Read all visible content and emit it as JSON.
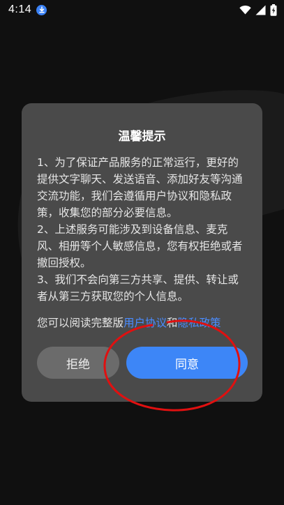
{
  "status_bar": {
    "time": "4:14",
    "icons": [
      "download-icon",
      "wifi-icon",
      "signal-icon",
      "battery-charging-icon"
    ]
  },
  "dialog": {
    "title": "温馨提示",
    "paragraphs": [
      "1、为了保证产品服务的正常运行，更好的提供文字聊天、发送语音、添加好友等沟通交流功能，我们会遵循用户协议和隐私政策，收集您的部分必要信息。",
      "2、上述服务可能涉及到设备信息、麦克风、相册等个人敏感信息，您有权拒绝或者撤回授权。",
      "3、我们不会向第三方共享、提供、转让或者从第三方获取您的个人信息。"
    ],
    "read_prefix": "您可以阅读完整版",
    "user_agreement_link": "用户协议",
    "and_text": "和",
    "privacy_policy_link": "隐私政策",
    "reject_label": "拒绝",
    "agree_label": "同意"
  },
  "colors": {
    "background": "#101010",
    "dialog_bg": "#4a4a4a",
    "link": "#4a8cff",
    "agree_button": "#3d86f7",
    "reject_button": "#6b6b6b",
    "annotation_circle": "#e01010"
  }
}
